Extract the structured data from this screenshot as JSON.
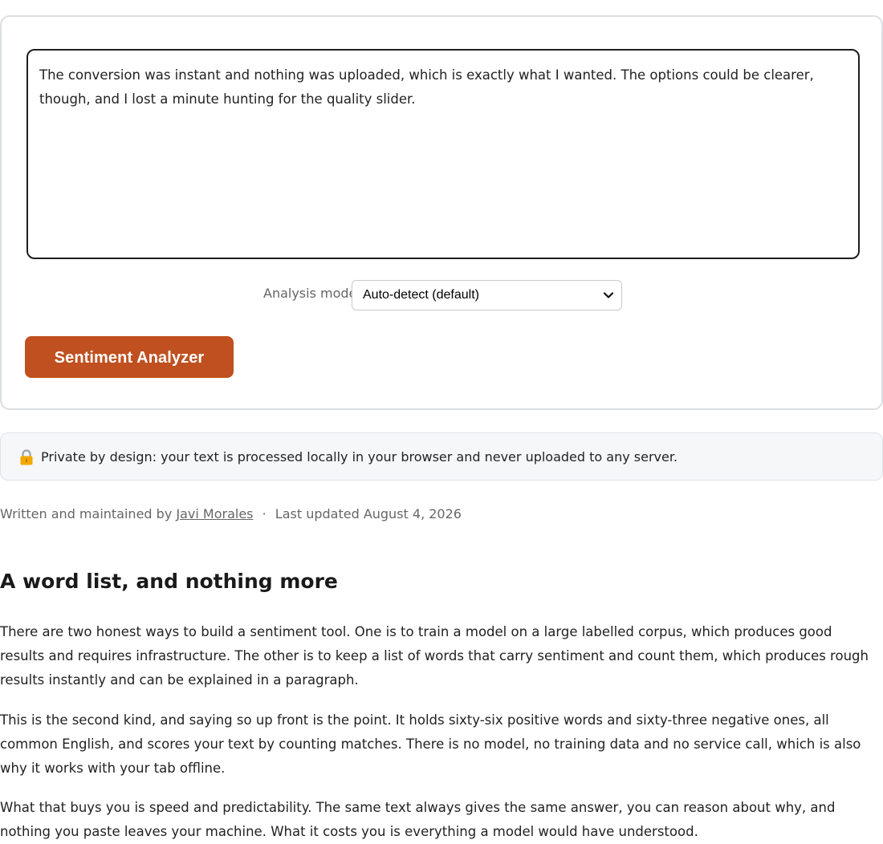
{
  "tool": {
    "text_input_value": "The conversion was instant and nothing was uploaded, which is exactly what I wanted. The options could be clearer, though, and I lost a minute hunting for the quality slider.",
    "mode_label": "Analysis mode",
    "mode_selected": "Auto-detect (default)",
    "analyze_label": "Sentiment Analyzer"
  },
  "privacy": {
    "icon": "lock-icon",
    "text": "Private by design: your text is processed locally in your browser and never uploaded to any server."
  },
  "byline": {
    "prefix": "Written and maintained by",
    "author": "Javi Morales",
    "separator": "·",
    "updated": "Last updated August 4, 2026"
  },
  "article": {
    "heading": "A word list, and nothing more",
    "paragraphs": [
      "There are two honest ways to build a sentiment tool. One is to train a model on a large labelled corpus, which produces good results and requires infrastructure. The other is to keep a list of words that carry sentiment and count them, which produces rough results instantly and can be explained in a paragraph.",
      "This is the second kind, and saying so up front is the point. It holds sixty-six positive words and sixty-three negative ones, all common English, and scores your text by counting matches. There is no model, no training data and no service call, which is also why it works with your tab offline.",
      "What that buys you is speed and predictability. The same text always gives the same answer, you can reason about why, and nothing you paste leaves your machine. What it costs you is everything a model would have understood."
    ]
  },
  "colors": {
    "accent": "#c0501f",
    "card_border": "#dcdfe2",
    "note_background": "#f5f7f9"
  }
}
